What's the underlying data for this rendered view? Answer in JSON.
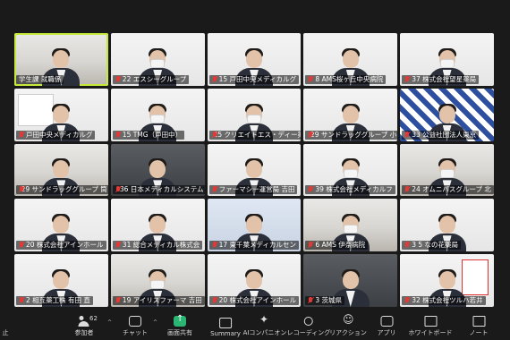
{
  "participants": [
    {
      "label": "学生課 就職係",
      "style": "office",
      "active": true,
      "muted": false,
      "mask": false
    },
    {
      "label": "22 エスシーグループ",
      "style": "white",
      "muted": true,
      "mask": true
    },
    {
      "label": "15 戸田中央メディカルグ",
      "style": "white",
      "muted": true,
      "mask": false
    },
    {
      "label": "8 AMS桜ヶ丘中央病院",
      "style": "white",
      "muted": true,
      "mask": false
    },
    {
      "label": "37 株式会社望星薬局",
      "style": "white",
      "muted": true,
      "mask": true
    },
    {
      "label": "戸田中央メディカルグ",
      "style": "white",
      "muted": true,
      "mask": false,
      "sign": true
    },
    {
      "label": "15 TMG（戸田中）",
      "style": "white",
      "muted": true,
      "mask": true
    },
    {
      "label": "25 クリエイトエス・ディー薬",
      "style": "white",
      "muted": true,
      "mask": true
    },
    {
      "label": "29 サンドラッググループ 小",
      "style": "white",
      "muted": true,
      "mask": false
    },
    {
      "label": "33 公益社団法人東京",
      "style": "pattern",
      "muted": true,
      "mask": false
    },
    {
      "label": "29 サンドラッググループ 筒",
      "style": "office",
      "muted": true,
      "mask": false
    },
    {
      "label": "36 日本メディカルシステム",
      "style": "dark",
      "muted": true,
      "mask": false
    },
    {
      "label": "ファーマシー運営局 吉田",
      "style": "white",
      "muted": true,
      "mask": false
    },
    {
      "label": "39 株式会社メディカルフ",
      "style": "white",
      "muted": true,
      "mask": true
    },
    {
      "label": "24 オムニバスグループ 北",
      "style": "office",
      "muted": true,
      "mask": true
    },
    {
      "label": "20 株式会社アインホール",
      "style": "white",
      "muted": true,
      "mask": false
    },
    {
      "label": "31 総合メディカル株式会",
      "style": "white",
      "muted": true,
      "mask": false
    },
    {
      "label": "17 東千葉メディカルセン",
      "style": "blue",
      "muted": true,
      "mask": false
    },
    {
      "label": "6 AMS 伊奈病院",
      "style": "office",
      "muted": true,
      "mask": true
    },
    {
      "label": "3 5 なの花薬局",
      "style": "white",
      "muted": true,
      "mask": false
    },
    {
      "label": "2 相互薬工株 有田 直",
      "style": "white",
      "muted": true,
      "mask": false
    },
    {
      "label": "19 アイリスファーマ 吉田",
      "style": "office",
      "muted": true,
      "mask": true
    },
    {
      "label": "20 株式会社アインホール",
      "style": "white",
      "muted": true,
      "mask": false
    },
    {
      "label": "3 茨城県",
      "style": "dark",
      "muted": true,
      "mask": false
    },
    {
      "label": "32 株式会社ツルハ若井",
      "style": "white",
      "muted": true,
      "mask": false,
      "card": true
    }
  ],
  "toolbar": {
    "left_cut": "止",
    "participants": {
      "label": "参加者",
      "count": "62"
    },
    "chat": "チャット",
    "share": "画面共有",
    "summary": "Summary",
    "ai": "AIコンパニオン",
    "record": "レコーディング",
    "reactions": "リアクション",
    "apps": "アプリ",
    "whiteboard": "ホワイトボード",
    "notes": "ノート"
  },
  "colors": {
    "background": "#1a1a1a",
    "active_speaker": "#c6ea3a",
    "share_green": "#2bb673",
    "mute_red": "#e53935"
  }
}
